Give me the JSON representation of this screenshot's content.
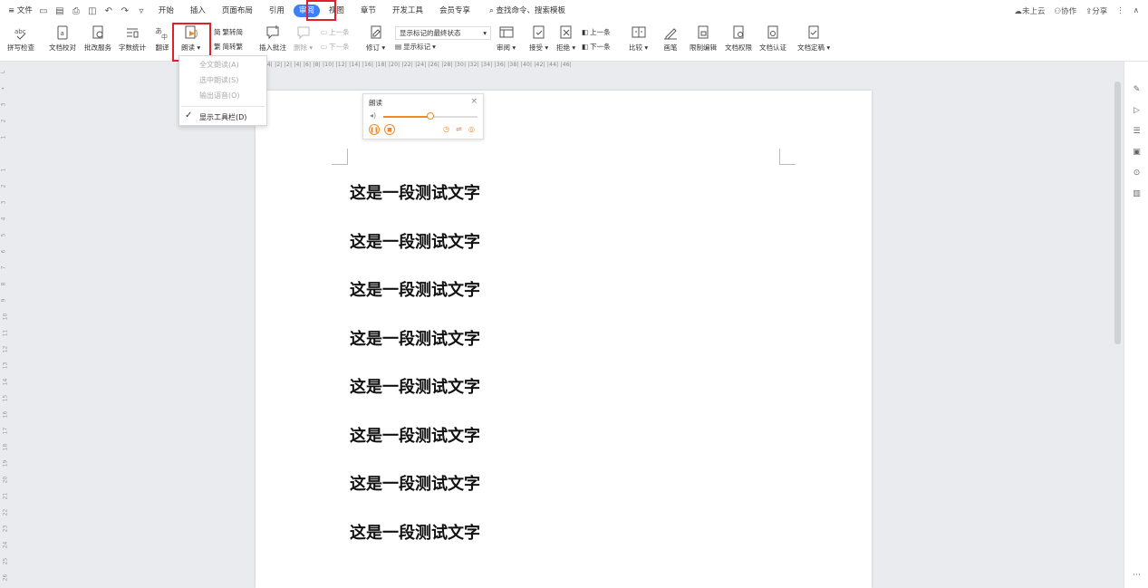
{
  "menubar": {
    "file": "≡ 文件",
    "tabs": [
      "开始",
      "插入",
      "页面布局",
      "引用",
      "审阅",
      "视图",
      "章节",
      "开发工具",
      "会员专享"
    ],
    "active_tab": "审阅",
    "search": "查找命令、搜索模板",
    "right": {
      "cloud": "未上云",
      "collab": "协作",
      "share": "分享"
    }
  },
  "ribbon": {
    "spell": "拼写检查",
    "doc_proof": "文档校对",
    "batch": "批改服务",
    "wordcount": "字数统计",
    "translate": "翻译",
    "read": "朗读",
    "trad": "繁转简",
    "simp": "简转繁",
    "insert_comment": "插入批注",
    "delete": "删除",
    "prev_comment": "上一条",
    "next_comment": "下一条",
    "revise": "修订",
    "markup_state": "显示标记的最终状态",
    "show_markup": "显示标记",
    "review": "审阅",
    "accept": "接受",
    "reject": "拒绝",
    "prev": "上一条",
    "next": "下一条",
    "compare": "比较",
    "pen": "画笔",
    "restrict": "限制编辑",
    "perm": "文档权限",
    "cert": "文档认证",
    "final": "文档定稿"
  },
  "dropdown": {
    "items": [
      "全文朗读(A)",
      "选中朗读(S)",
      "输出语音(O)",
      "显示工具栏(D)"
    ]
  },
  "readbar": {
    "title": "朗读",
    "volume_level": 0.5
  },
  "ruler": "|6| |4| |2| |2| |4| |6| |8| |10| |12| |14| |16| |18| |20| |22| |24| |26| |28| |30| |32| |34| |36| |38| |40| |42| |44| |46|",
  "document": {
    "lines": [
      "这是一段测试文字",
      "这是一段测试文字",
      "这是一段测试文字",
      "这是一段测试文字",
      "这是一段测试文字",
      "这是一段测试文字",
      "这是一段测试文字",
      "这是一段测试文字"
    ]
  },
  "colors": {
    "accent": "#3d7ff5",
    "highlight": "#e0202a",
    "orange": "#f08a24"
  }
}
